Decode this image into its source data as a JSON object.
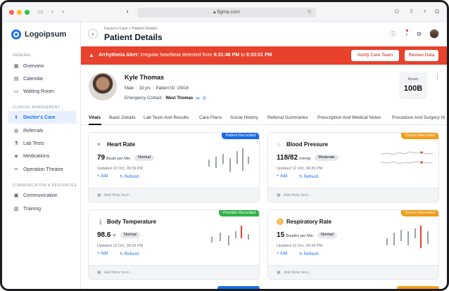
{
  "browser": {
    "url": "figma.com"
  },
  "sidebar": {
    "logo": "Logoipsum",
    "sections": [
      {
        "title": "GENERAL",
        "items": [
          {
            "label": "Overview",
            "icon": "grid-icon"
          },
          {
            "label": "Calendar",
            "icon": "calendar-icon"
          },
          {
            "label": "Waiting Room",
            "icon": "monitor-icon"
          }
        ]
      },
      {
        "title": "CLINICAL MANAGEMENT",
        "items": [
          {
            "label": "Doctor's Care",
            "icon": "stethoscope-icon",
            "active": true
          },
          {
            "label": "Referrals",
            "icon": "globe-icon"
          },
          {
            "label": "Lab Tests",
            "icon": "flask-icon"
          },
          {
            "label": "Medications",
            "icon": "pill-icon"
          },
          {
            "label": "Operation Theatre",
            "icon": "scissors-icon"
          }
        ]
      },
      {
        "title": "COMMUNICATION & RESOURCES",
        "items": [
          {
            "label": "Communication",
            "icon": "chat-icon"
          },
          {
            "label": "Training",
            "icon": "book-icon"
          }
        ]
      }
    ]
  },
  "header": {
    "breadcrumb": [
      "Doctor's Care",
      "Patient Details"
    ],
    "breadcrumb_sep": ">",
    "title": "Patient Details"
  },
  "alert": {
    "prefix": "Arrhythmia Alert:",
    "message": "Irregular heartbeat detected from",
    "from": "9:31:48 PM",
    "to_word": "to",
    "to": "9:33:01 PM",
    "buttons": [
      "Notify Care Team",
      "Review Data"
    ]
  },
  "patient": {
    "name": "Kyle Thomas",
    "gender": "Male",
    "age": "33 yrs",
    "id": "Patient ID: 15018",
    "emergency_label": "Emergency Contact:",
    "emergency_name": "West Thomas",
    "room_label": "Room",
    "room": "100B"
  },
  "tabs": [
    "Vitals",
    "Basic Details",
    "Lab Tests And Results",
    "Care Plans",
    "Social History",
    "Referral Summaries",
    "Prescription And Medical Notes",
    "Procedure And Surgery Hi"
  ],
  "vitals": [
    {
      "title": "Heart Rate",
      "icon": "heart-icon",
      "value": "79",
      "unit": "Beats per Min",
      "status": "Normal",
      "badge": "Patient Recorded",
      "badge_color": "#1a6be8",
      "updated": "Updated 12 Oct, 09:39 PM",
      "add": "Add",
      "refresh": "Refresh",
      "note": "Add Note here..."
    },
    {
      "title": "Blood Pressure",
      "icon": "drop-icon",
      "value": "118/82",
      "unit": "mmHg",
      "status": "Moderate",
      "badge": "Device Recorded",
      "badge_color": "#f29d18",
      "updated": "Updated 12 Oct, 09:39 PM",
      "add": "Add",
      "refresh": "Refresh",
      "note": "Add Note here..."
    },
    {
      "title": "Body Temperature",
      "icon": "thermometer-icon",
      "value": "98.6",
      "unit": "°F",
      "status": "Normal",
      "badge": "Provider Recorded",
      "badge_color": "#33b24a",
      "updated": "Updated 12 Oct, 09:39 PM",
      "add": "Add",
      "refresh": "Refresh",
      "note": "Add Note here..."
    },
    {
      "title": "Respiratory Rate",
      "icon": "lungs-icon",
      "value": "15",
      "unit": "Breaths per Min",
      "status": "Normal",
      "badge": "Device Recorded",
      "badge_color": "#f29d18",
      "updated": "Updated 12 Oct, 09:39 PM",
      "add": "Add",
      "refresh": "Refresh",
      "note": "Add Note here..."
    }
  ],
  "colors": {
    "accent": "#1a73e8",
    "alert": "#e8412c",
    "highlight_bar": "#e8412c"
  }
}
